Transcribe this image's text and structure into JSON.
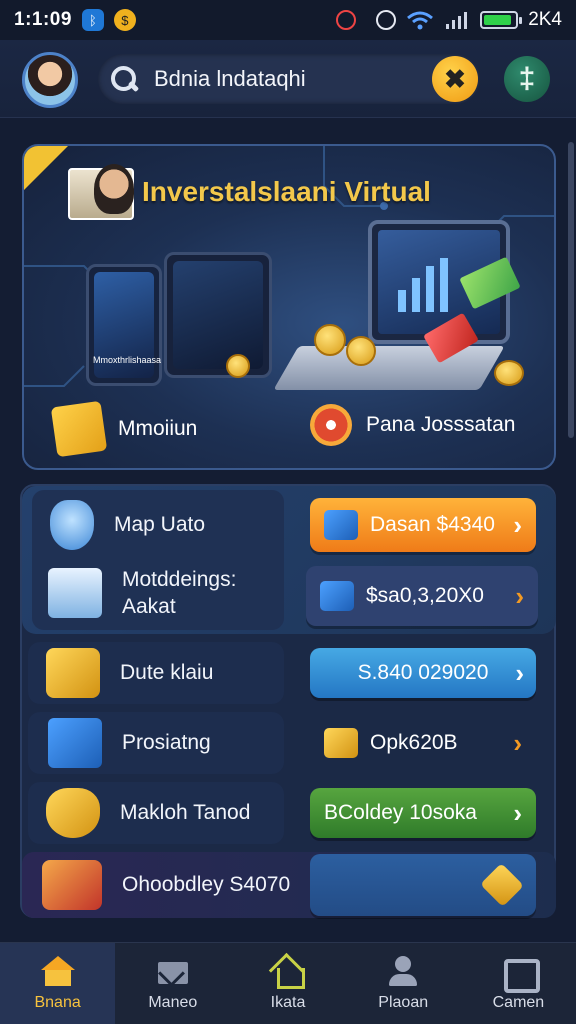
{
  "status_bar": {
    "time": "1:1:09",
    "right_text": "2K4",
    "icons": [
      "bluetooth-icon",
      "coin-icon",
      "record-icon",
      "alarm-icon",
      "wifi-icon",
      "signal-icon",
      "battery-icon"
    ],
    "battery_level": 0.9
  },
  "header": {
    "search_value": "Bdnia lndataqhi",
    "chat_symbol": "✖",
    "plus_symbol": "‡"
  },
  "banner": {
    "title": "Inverstalslaani Virtual",
    "items": [
      {
        "label": "Mmoiiun",
        "icon": "gold-box-icon"
      },
      {
        "label": "Pana Josssatan",
        "icon": "medal-icon"
      }
    ],
    "device_label": "Mmoxthrlishaasa"
  },
  "panel": {
    "rows": [
      {
        "label": "Map Uato",
        "icon": "shield-icon",
        "button": "Dasan $4340",
        "button_style": "orange"
      },
      {
        "label": "Motddeings: Aakat",
        "icon": "store-icon",
        "button": "$sa0,3,20X0",
        "button_style": "navy"
      },
      {
        "label": "Dute klaiu",
        "icon": "gold-bars-icon",
        "button": "S.840 029020",
        "button_style": "blue"
      },
      {
        "label": "Prosiatng",
        "icon": "coin-cube-icon",
        "button": "Opk620B",
        "button_style": "plain"
      },
      {
        "label": "Makloh Tanod",
        "icon": "gold-shield-icon",
        "button": "BColdey 10soka",
        "button_style": "green"
      },
      {
        "label": "Ohoobdley S4070",
        "icon": "treasure-chest-icon",
        "button": "",
        "button_style": "empty"
      }
    ],
    "arrow": "›"
  },
  "tabbar": {
    "tabs": [
      {
        "label": "Bnana",
        "icon": "home-icon",
        "active": true
      },
      {
        "label": "Maneo",
        "icon": "mail-icon",
        "active": false
      },
      {
        "label": "Ikata",
        "icon": "house-icon",
        "active": false
      },
      {
        "label": "Plaoan",
        "icon": "user-icon",
        "active": false
      },
      {
        "label": "Camen",
        "icon": "screen-icon",
        "active": false
      }
    ]
  },
  "colors": {
    "background": "#141d33",
    "accent_gold": "#f3c84b",
    "accent_orange": "#ef7b18",
    "accent_green": "#2f7b2a",
    "accent_blue": "#2477c4"
  }
}
